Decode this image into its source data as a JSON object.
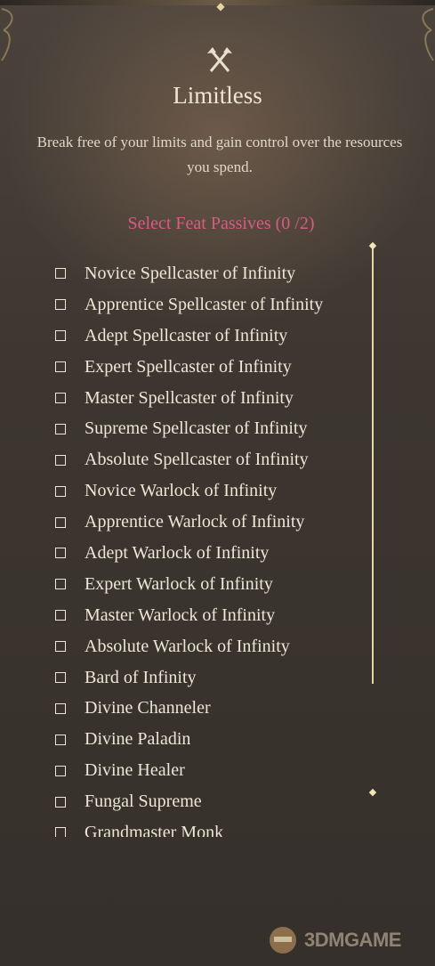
{
  "feat": {
    "icon": "crossed-axes-icon",
    "title": "Limitless",
    "description": "Break free of your limits and gain control over the resources you spend.",
    "select_header": "Select Feat Passives  (0 /2)"
  },
  "passives": [
    {
      "label": "Novice Spellcaster of Infinity",
      "checked": false
    },
    {
      "label": "Apprentice Spellcaster of Infinity",
      "checked": false
    },
    {
      "label": "Adept Spellcaster of Infinity",
      "checked": false
    },
    {
      "label": "Expert Spellcaster of Infinity",
      "checked": false
    },
    {
      "label": "Master Spellcaster of Infinity",
      "checked": false
    },
    {
      "label": "Supreme Spellcaster of Infinity",
      "checked": false
    },
    {
      "label": "Absolute Spellcaster of Infinity",
      "checked": false
    },
    {
      "label": "Novice Warlock of Infinity",
      "checked": false
    },
    {
      "label": "Apprentice Warlock of Infinity",
      "checked": false
    },
    {
      "label": "Adept Warlock of Infinity",
      "checked": false
    },
    {
      "label": "Expert Warlock of Infinity",
      "checked": false
    },
    {
      "label": "Master Warlock of Infinity",
      "checked": false
    },
    {
      "label": "Absolute Warlock of Infinity",
      "checked": false
    },
    {
      "label": "Bard of Infinity",
      "checked": false
    },
    {
      "label": "Divine Channeler",
      "checked": false
    },
    {
      "label": "Divine Paladin",
      "checked": false
    },
    {
      "label": "Divine Healer",
      "checked": false
    },
    {
      "label": "Fungal Supreme",
      "checked": false
    },
    {
      "label": "Grandmaster Monk",
      "checked": false
    }
  ],
  "watermark": {
    "text": "3DMGAME"
  },
  "colors": {
    "accent": "#d95b82",
    "text": "#efe6d6",
    "gold": "#e6d6a4",
    "background": "#3d3630"
  }
}
